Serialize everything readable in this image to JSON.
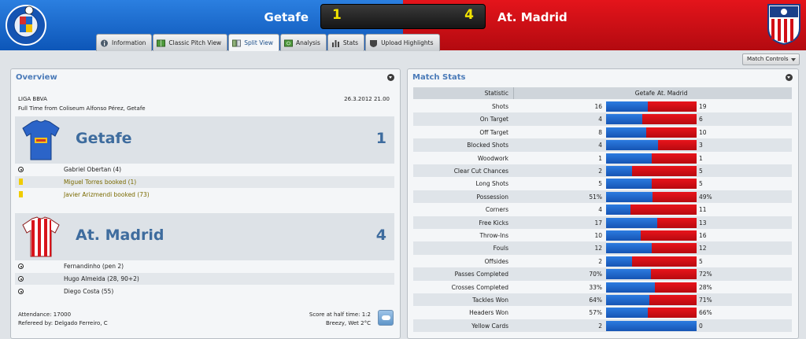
{
  "header": {
    "home_team": "Getafe",
    "away_team": "At. Madrid",
    "home_score": "1",
    "away_score": "4",
    "home_crest_text": "GETAFE C.F. S.A.D.",
    "home_color": "#1a66c9",
    "away_color": "#d10f16"
  },
  "tabs": [
    {
      "label": "Information",
      "icon": "info-icon"
    },
    {
      "label": "Classic Pitch View",
      "icon": "pitch-icon"
    },
    {
      "label": "Split View",
      "icon": "split-view-icon",
      "active": true
    },
    {
      "label": "Analysis",
      "icon": "analysis-icon"
    },
    {
      "label": "Stats",
      "icon": "stats-icon"
    },
    {
      "label": "Upload Highlights",
      "icon": "upload-icon"
    }
  ],
  "match_controls": "Match Controls",
  "overview": {
    "title": "Overview",
    "league": "LIGA BBVA",
    "date": "26.3.2012 21.00",
    "fulltime": "Full Time from Coliseum Alfonso Pérez, Getafe",
    "home": {
      "name": "Getafe",
      "score": "1",
      "events": [
        {
          "type": "goal",
          "text": "Gabriel Obertan (4)"
        },
        {
          "type": "booking",
          "text": "Miguel Torres booked (1)"
        },
        {
          "type": "booking",
          "text": "Javier Arizmendi booked (73)"
        }
      ]
    },
    "away": {
      "name": "At. Madrid",
      "score": "4",
      "events": [
        {
          "type": "goal",
          "text": "Fernandinho (pen 2)"
        },
        {
          "type": "goal",
          "text": "Hugo Almeida (28, 90+2)"
        },
        {
          "type": "goal",
          "text": "Diego Costa (55)"
        }
      ]
    },
    "attendance": "Attendance: 17000",
    "referee": "Refereed by: Delgado Ferreiro, C",
    "halftime": "Score at half time: 1:2",
    "weather": "Breezy, Wet 2°C"
  },
  "match_stats": {
    "title": "Match Stats",
    "col_stat": "Statistic",
    "col_home": "Getafe",
    "col_away": "At. Madrid",
    "rows": [
      {
        "name": "Shots",
        "home": "16",
        "away": "19",
        "h": 16,
        "a": 19
      },
      {
        "name": "On Target",
        "home": "4",
        "away": "6",
        "h": 4,
        "a": 6
      },
      {
        "name": "Off Target",
        "home": "8",
        "away": "10",
        "h": 8,
        "a": 10
      },
      {
        "name": "Blocked Shots",
        "home": "4",
        "away": "3",
        "h": 4,
        "a": 3
      },
      {
        "name": "Woodwork",
        "home": "1",
        "away": "1",
        "h": 1,
        "a": 1
      },
      {
        "name": "Clear Cut Chances",
        "home": "2",
        "away": "5",
        "h": 2,
        "a": 5
      },
      {
        "name": "Long Shots",
        "home": "5",
        "away": "5",
        "h": 5,
        "a": 5
      },
      {
        "name": "Possession",
        "home": "51%",
        "away": "49%",
        "h": 51,
        "a": 49
      },
      {
        "name": "Corners",
        "home": "4",
        "away": "11",
        "h": 4,
        "a": 11
      },
      {
        "name": "Free Kicks",
        "home": "17",
        "away": "13",
        "h": 17,
        "a": 13
      },
      {
        "name": "Throw-Ins",
        "home": "10",
        "away": "16",
        "h": 10,
        "a": 16
      },
      {
        "name": "Fouls",
        "home": "12",
        "away": "12",
        "h": 12,
        "a": 12
      },
      {
        "name": "Offsides",
        "home": "2",
        "away": "5",
        "h": 2,
        "a": 5
      },
      {
        "name": "Passes Completed",
        "home": "70%",
        "away": "72%",
        "h": 70,
        "a": 72
      },
      {
        "name": "Crosses Completed",
        "home": "33%",
        "away": "28%",
        "h": 33,
        "a": 28
      },
      {
        "name": "Tackles Won",
        "home": "64%",
        "away": "71%",
        "h": 64,
        "a": 71
      },
      {
        "name": "Headers Won",
        "home": "57%",
        "away": "66%",
        "h": 57,
        "a": 66
      },
      {
        "name": "Yellow Cards",
        "home": "2",
        "away": "0",
        "h": 2,
        "a": 0
      }
    ]
  }
}
